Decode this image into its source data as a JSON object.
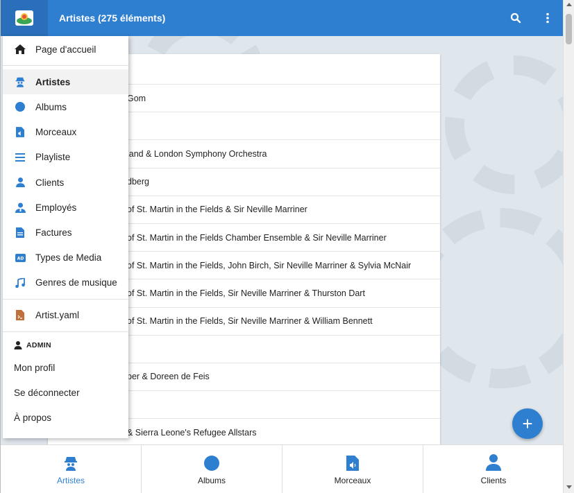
{
  "topbar": {
    "title": "Artistes (275 éléments)",
    "logo_icon": "app-logo-icon",
    "search_icon": "search-icon",
    "more_icon": "more-vert-icon",
    "color": "#2f7fd1"
  },
  "list": {
    "rows": [
      "Gom",
      "",
      "land & London Symphony Orchestra",
      "dberg",
      "of St. Martin in the Fields & Sir Neville Marriner",
      "of St. Martin in the Fields Chamber Ensemble & Sir Neville Marriner",
      "of St. Martin in the Fields, John Birch, Sir Neville Marriner & Sylvia McNair",
      "of St. Martin in the Fields, Sir Neville Marriner & Thurston Dart",
      "of St. Martin in the Fields, Sir Neville Marriner & William Bennett",
      "",
      "per & Doreen de Feis",
      "",
      "& Sierra Leone's Refugee Allstars"
    ]
  },
  "drawer": {
    "home": {
      "label": "Page d'accueil",
      "icon": "home-icon"
    },
    "items": [
      {
        "label": "Artistes",
        "icon": "artist-icon",
        "active": true
      },
      {
        "label": "Albums",
        "icon": "album-icon"
      },
      {
        "label": "Morceaux",
        "icon": "track-icon"
      },
      {
        "label": "Playliste",
        "icon": "playlist-icon"
      },
      {
        "label": "Clients",
        "icon": "client-icon"
      },
      {
        "label": "Employés",
        "icon": "employees-icon"
      },
      {
        "label": "Factures",
        "icon": "invoice-icon"
      },
      {
        "label": "Types de Media",
        "icon": "media-type-icon"
      },
      {
        "label": "Genres de musique",
        "icon": "music-note-icon"
      }
    ],
    "yaml": {
      "label": "Artist.yaml",
      "icon": "yaml-file-icon"
    },
    "section": {
      "label": "ADMIN",
      "icon": "user-icon"
    },
    "admin_links": [
      "Mon profil",
      "Se déconnecter",
      "À propos"
    ]
  },
  "fab": {
    "label": "+",
    "icon": "add-icon"
  },
  "bottom_nav": [
    {
      "label": "Artistes",
      "icon": "artist-icon",
      "active": true
    },
    {
      "label": "Albums",
      "icon": "album-icon"
    },
    {
      "label": "Morceaux",
      "icon": "track-icon"
    },
    {
      "label": "Clients",
      "icon": "client-icon"
    }
  ],
  "colors": {
    "accent": "#2f7fd1"
  }
}
